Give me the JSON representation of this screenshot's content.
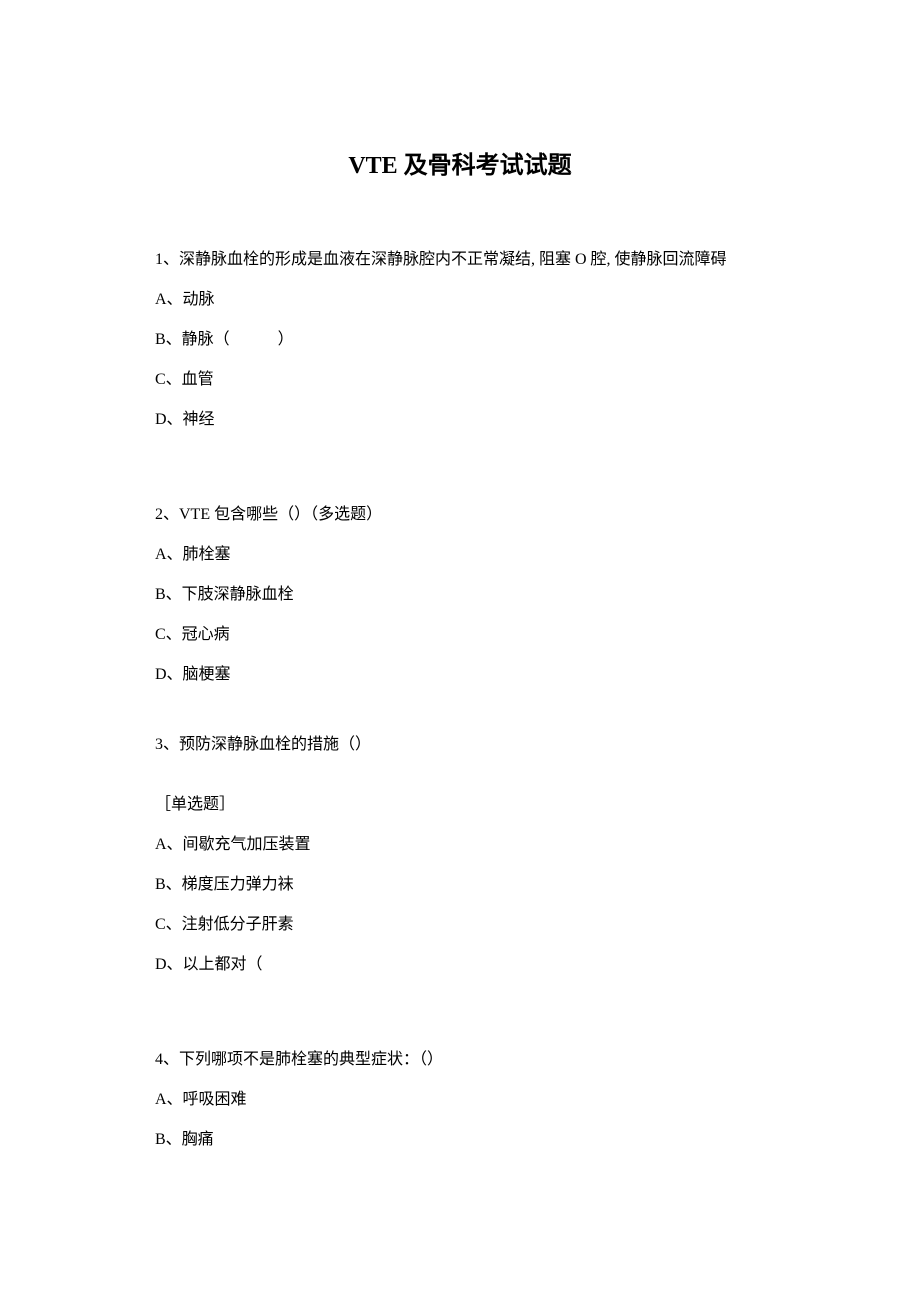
{
  "title": "VTE 及骨科考试试题",
  "q1": {
    "text": "1、深静脉血栓的形成是血液在深静脉腔内不正常凝结, 阻塞 O 腔, 使静脉回流障碍",
    "optA": "A、动脉",
    "optB": "B、静脉（　　　）",
    "optC": "C、血管",
    "optD": "D、神经"
  },
  "q2": {
    "text": "2、VTE 包含哪些（）（多选题）",
    "optA": "A、肺栓塞",
    "optB": "B、下肢深静脉血栓",
    "optC": "C、冠心病",
    "optD": "D、脑梗塞"
  },
  "q3": {
    "text": "3、预防深静脉血栓的措施（）",
    "note": "［单选题］",
    "optA": "A、间歇充气加压装置",
    "optB": "B、梯度压力弹力袜",
    "optC": "C、注射低分子肝素",
    "optD": "D、以上都对（"
  },
  "q4": {
    "text": "4、下列哪项不是肺栓塞的典型症状：（）",
    "optA": "A、呼吸困难",
    "optB": "B、胸痛"
  }
}
